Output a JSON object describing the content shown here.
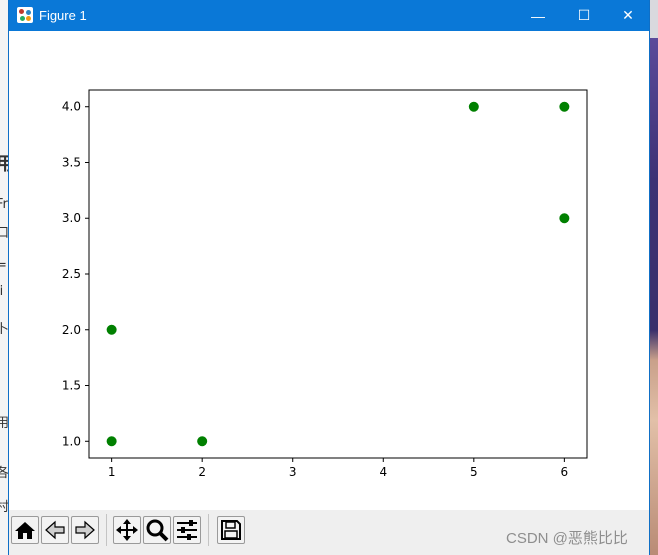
{
  "window": {
    "title": "Figure 1",
    "controls": {
      "minimize": "—",
      "maximize": "☐",
      "close": "✕"
    }
  },
  "toolbar": {
    "buttons": [
      {
        "name": "home-button",
        "icon": "home-icon"
      },
      {
        "name": "back-button",
        "icon": "arrow-left-icon"
      },
      {
        "name": "forward-button",
        "icon": "arrow-right-icon"
      },
      {
        "name": "pan-button",
        "icon": "move-icon"
      },
      {
        "name": "zoom-button",
        "icon": "magnifier-icon"
      },
      {
        "name": "configure-subplots-button",
        "icon": "sliders-icon"
      },
      {
        "name": "save-button",
        "icon": "floppy-disk-icon"
      }
    ]
  },
  "watermark": "CSDN @恶熊比比",
  "colors": {
    "titlebar": "#0a78d7",
    "points": "#008000"
  },
  "chart_data": {
    "type": "scatter",
    "title": "",
    "xlabel": "",
    "ylabel": "",
    "xlim": [
      0.75,
      6.25
    ],
    "ylim": [
      0.85,
      4.15
    ],
    "xticks": [
      1,
      2,
      3,
      4,
      5,
      6
    ],
    "yticks": [
      1.0,
      1.5,
      2.0,
      2.5,
      3.0,
      3.5,
      4.0
    ],
    "xtick_labels": [
      "1",
      "2",
      "3",
      "4",
      "5",
      "6"
    ],
    "ytick_labels": [
      "1.0",
      "1.5",
      "2.0",
      "2.5",
      "3.0",
      "3.5",
      "4.0"
    ],
    "grid": false,
    "series": [
      {
        "color": "#008000",
        "points": [
          {
            "x": 1,
            "y": 2
          },
          {
            "x": 1,
            "y": 1
          },
          {
            "x": 2,
            "y": 1
          },
          {
            "x": 5,
            "y": 4
          },
          {
            "x": 6,
            "y": 4
          },
          {
            "x": 6,
            "y": 3
          }
        ]
      }
    ]
  }
}
